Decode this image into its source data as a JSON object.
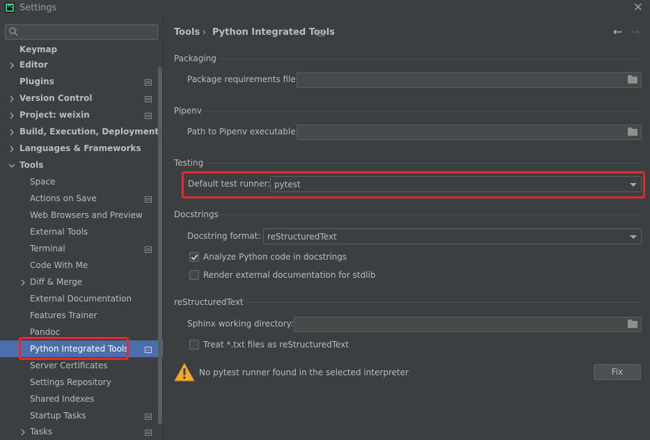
{
  "window": {
    "title": "Settings",
    "logo_text": "PC"
  },
  "search": {
    "placeholder": ""
  },
  "sidebar": {
    "items": [
      {
        "label": "Keymap"
      },
      {
        "label": "Editor"
      },
      {
        "label": "Plugins"
      },
      {
        "label": "Version Control"
      },
      {
        "label": "Project: weixin"
      },
      {
        "label": "Build, Execution, Deployment"
      },
      {
        "label": "Languages & Frameworks"
      },
      {
        "label": "Tools"
      },
      {
        "label": "Space"
      },
      {
        "label": "Actions on Save"
      },
      {
        "label": "Web Browsers and Preview"
      },
      {
        "label": "External Tools"
      },
      {
        "label": "Terminal"
      },
      {
        "label": "Code With Me"
      },
      {
        "label": "Diff & Merge"
      },
      {
        "label": "External Documentation"
      },
      {
        "label": "Features Trainer"
      },
      {
        "label": "Pandoc"
      },
      {
        "label": "Python Integrated Tools"
      },
      {
        "label": "Server Certificates"
      },
      {
        "label": "Settings Repository"
      },
      {
        "label": "Shared Indexes"
      },
      {
        "label": "Startup Tasks"
      },
      {
        "label": "Tasks"
      }
    ],
    "selected": "Python Integrated Tools"
  },
  "breadcrumb": {
    "parent": "Tools",
    "separator": "›",
    "current": "Python Integrated Tools"
  },
  "sections": {
    "packaging": {
      "title": "Packaging",
      "req_label": "Package requirements file:",
      "req_value": ""
    },
    "pipenv": {
      "title": "Pipenv",
      "path_label": "Path to Pipenv executable:",
      "path_value": ""
    },
    "testing": {
      "title": "Testing",
      "runner_label": "Default test runner:",
      "runner_value": "pytest"
    },
    "docstrings": {
      "title": "Docstrings",
      "format_label": "Docstring format:",
      "format_value": "reStructuredText",
      "analyze_label": "Analyze Python code in docstrings",
      "analyze_checked": true,
      "render_label": "Render external documentation for stdlib",
      "render_checked": false
    },
    "rest": {
      "title": "reStructuredText",
      "sphinx_label": "Sphinx working directory:",
      "sphinx_value": "",
      "treat_label": "Treat *.txt files as reStructuredText",
      "treat_checked": false
    }
  },
  "warning": {
    "text": "No pytest runner found in the selected interpreter",
    "fix_label": "Fix"
  },
  "colors": {
    "background": "#3c3f41",
    "selection": "#4b6eaf",
    "highlight": "#e8282a",
    "warning": "#f0a830"
  }
}
